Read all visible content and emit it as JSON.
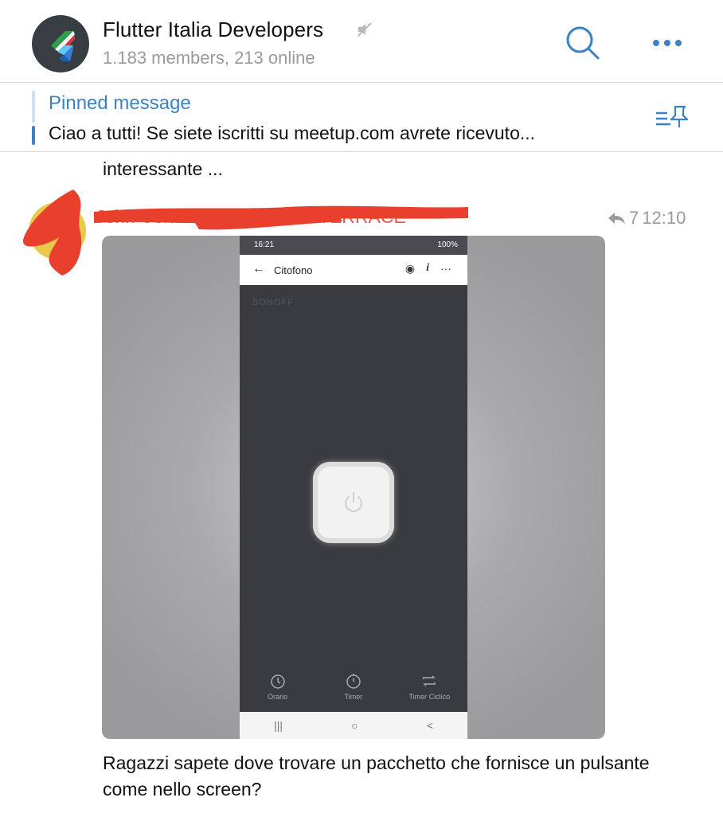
{
  "header": {
    "title": "Flutter Italia Developers",
    "subtitle": "1.183 members, 213 online"
  },
  "pinned": {
    "title": "Pinned message",
    "text": "Ciao a tutti!  Se siete iscritti su meetup.com avrete ricevuto..."
  },
  "messages": {
    "previous_text": "interessante ...",
    "sender_name": "John Cena · CODING MASTERRACE",
    "reply_count": "7",
    "time": "12:10",
    "caption": "Ragazzi sapete dove trovare un pacchetto che fornisce un pulsante come nello screen?"
  },
  "screenshot": {
    "status_time": "16:21",
    "status_battery": "100%",
    "app_title": "Citofono",
    "brand": "SONOFF",
    "tabs": [
      "Orario",
      "Timer",
      "Timer Ciclico"
    ],
    "nav": [
      "|||",
      "○",
      "<"
    ]
  },
  "colors": {
    "accent": "#3b82c4",
    "name_red": "#e95a4b",
    "scribble": "#e8402c"
  }
}
